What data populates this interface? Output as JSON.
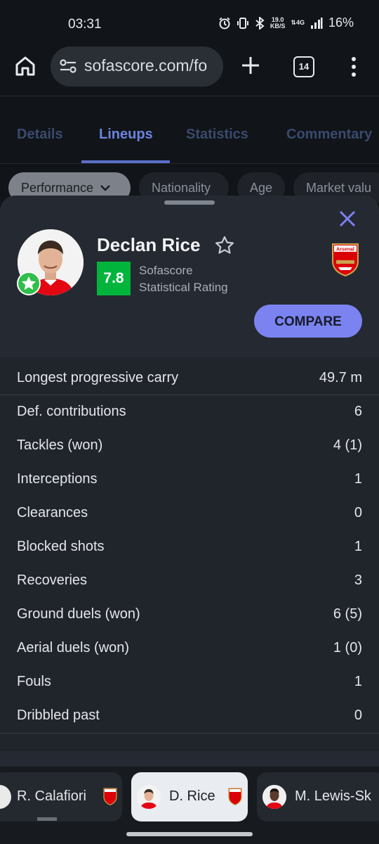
{
  "status_bar": {
    "time": "03:31",
    "speed_top": "19.0",
    "speed_bottom": "KB/S",
    "net_top": "⇅4G",
    "battery": "16%"
  },
  "browser": {
    "url": "sofascore.com/fo",
    "tab_count": "14"
  },
  "background_tabs": [
    "Details",
    "Lineups",
    "Statistics",
    "Commentary"
  ],
  "active_tab": "Lineups",
  "filter_chips": [
    "Performance",
    "Nationality",
    "Age",
    "Market valu"
  ],
  "player": {
    "name": "Declan Rice",
    "rating": "7.8",
    "rating_label_1": "Sofascore",
    "rating_label_2": "Statistical Rating",
    "club": "Arsenal",
    "compare_label": "COMPARE"
  },
  "stats": [
    {
      "label": "Longest progressive carry",
      "value": "49.7 m"
    },
    {
      "label": "Def. contributions",
      "value": "6"
    },
    {
      "label": "Tackles (won)",
      "value": "4 (1)"
    },
    {
      "label": "Interceptions",
      "value": "1"
    },
    {
      "label": "Clearances",
      "value": "0"
    },
    {
      "label": "Blocked shots",
      "value": "1"
    },
    {
      "label": "Recoveries",
      "value": "3"
    },
    {
      "label": "Ground duels (won)",
      "value": "6 (5)"
    },
    {
      "label": "Aerial duels (won)",
      "value": "1 (0)"
    },
    {
      "label": "Fouls",
      "value": "1"
    },
    {
      "label": "Dribbled past",
      "value": "0"
    }
  ],
  "player_carousel": [
    {
      "name": "R. Calafiori"
    },
    {
      "name": "D. Rice"
    },
    {
      "name": "M. Lewis-Sk"
    }
  ],
  "colors": {
    "rating_green": "#00b43c",
    "accent": "#7b83f0",
    "arsenal_red": "#db0007"
  }
}
